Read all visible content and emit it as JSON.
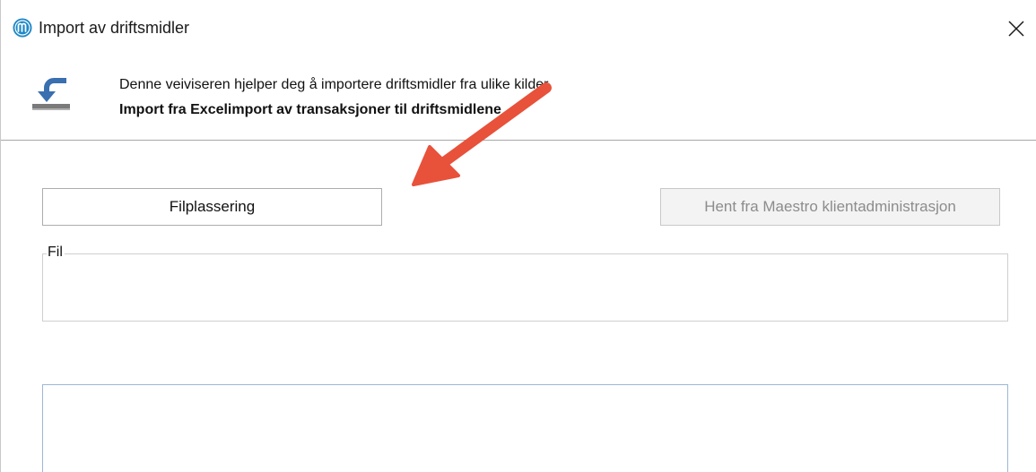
{
  "window": {
    "title": "Import av driftsmidler"
  },
  "header": {
    "line1": "Denne veiviseren hjelper deg å importere driftsmidler fra ulike kilder",
    "line2": "Import fra Excelimport av transaksjoner til driftsmidlene"
  },
  "buttons": {
    "file_location": "Filplassering",
    "maestro": "Hent fra Maestro klientadministrasjon"
  },
  "file_group": {
    "label": "Fil",
    "value": ""
  },
  "log": {
    "value": ""
  },
  "icons": {
    "app": "maestro-logo-icon",
    "import": "import-icon",
    "close": "close-icon"
  },
  "colors": {
    "app_icon": "#1e88c8",
    "import_icon": "#3a6fb0",
    "annotation_arrow": "#e8513a",
    "disabled_text": "#8c8c8c"
  }
}
